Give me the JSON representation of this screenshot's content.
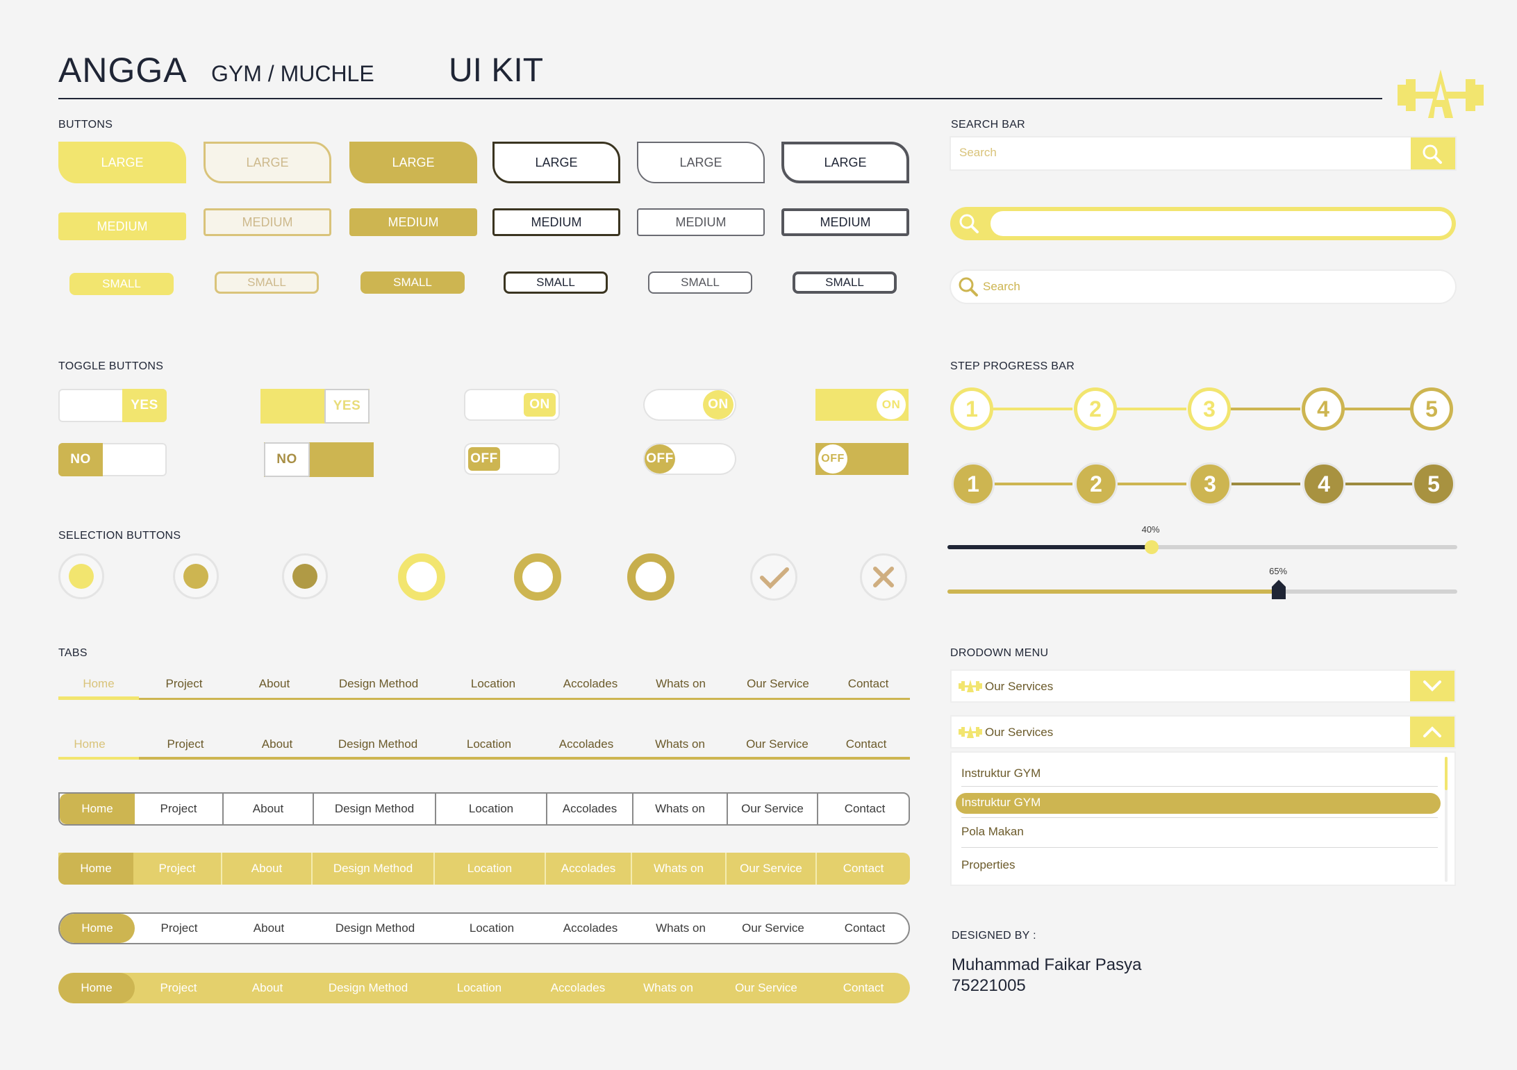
{
  "header": {
    "brand": "ANGGA",
    "subtitle": "GYM / MUCHLE",
    "kit": "UI KIT",
    "logo": "gym-dumbbell-logo-icon"
  },
  "colors": {
    "yellow": "#f2e56f",
    "gold": "#cdb551",
    "dark_gold": "#b09a45",
    "navy": "#1f2535"
  },
  "sections": {
    "buttons": "BUTTONS",
    "toggles": "TOGGLE BUTTONS",
    "selection": "SELECTION BUTTONS",
    "tabs": "TABS",
    "search": "SEARCH BAR",
    "steps": "STEP PROGRESS BAR",
    "dropdown": "DRODOWN MENU",
    "designed": "DESIGNED BY :"
  },
  "buttons": {
    "large": "LARGE",
    "medium": "MEDIUM",
    "small": "SMALL"
  },
  "toggles": {
    "yes": "YES",
    "no": "NO",
    "on": "ON",
    "off": "OFF"
  },
  "tabs": [
    "Home",
    "Project",
    "About",
    "Design Method",
    "Location",
    "Accolades",
    "Whats on",
    "Our Service",
    "Contact"
  ],
  "search": {
    "placeholder": "Search",
    "icon": "search-icon"
  },
  "steps": [
    "1",
    "2",
    "3",
    "4",
    "5"
  ],
  "sliders": [
    {
      "label": "40%",
      "value": 0.4
    },
    {
      "label": "65%",
      "value": 0.65
    }
  ],
  "dropdown": {
    "selected": "Our Services",
    "items": [
      "Instruktur GYM",
      "Instruktur GYM",
      "Pola Makan",
      "Properties"
    ]
  },
  "designer": {
    "name": "Muhammad Faikar Pasya",
    "id": "75221005"
  }
}
